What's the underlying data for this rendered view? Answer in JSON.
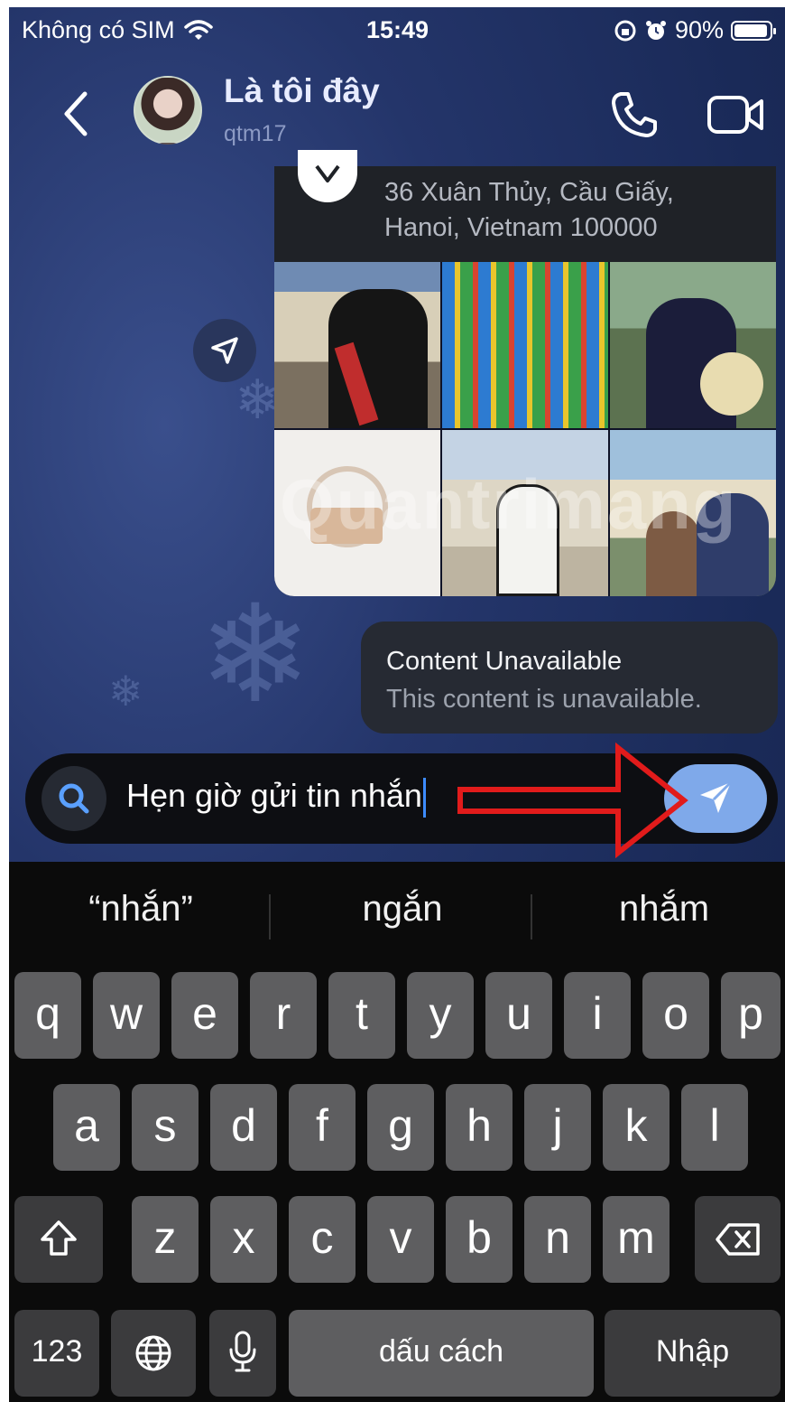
{
  "status_bar": {
    "carrier": "Không có SIM",
    "time": "15:49",
    "battery": "90%",
    "battery_level": 0.9
  },
  "header": {
    "name": "Là tôi đây",
    "username": "qtm17"
  },
  "location_card": {
    "address_line1": "36 Xuân Thủy, Cầu Giấy,",
    "address_line2": "Hanoi, Vietnam 100000"
  },
  "watermark": "Quantrimang",
  "unavailable_message": {
    "title": "Content Unavailable",
    "body": "This content is unavailable."
  },
  "composer": {
    "text": "Hẹn giờ gửi tin nhắn"
  },
  "keyboard": {
    "suggestions": [
      "“nhắn”",
      "ngắn",
      "nhắm"
    ],
    "row1": [
      "q",
      "w",
      "e",
      "r",
      "t",
      "y",
      "u",
      "i",
      "o",
      "p"
    ],
    "row2": [
      "a",
      "s",
      "d",
      "f",
      "g",
      "h",
      "j",
      "k",
      "l"
    ],
    "row3": [
      "z",
      "x",
      "c",
      "v",
      "b",
      "n",
      "m"
    ],
    "numbers_key": "123",
    "space_key": "dấu cách",
    "return_key": "Nhập"
  },
  "colors": {
    "accent_send": "#7fa9ea",
    "caret": "#3d8bff",
    "annotation": "#e11b1b"
  }
}
